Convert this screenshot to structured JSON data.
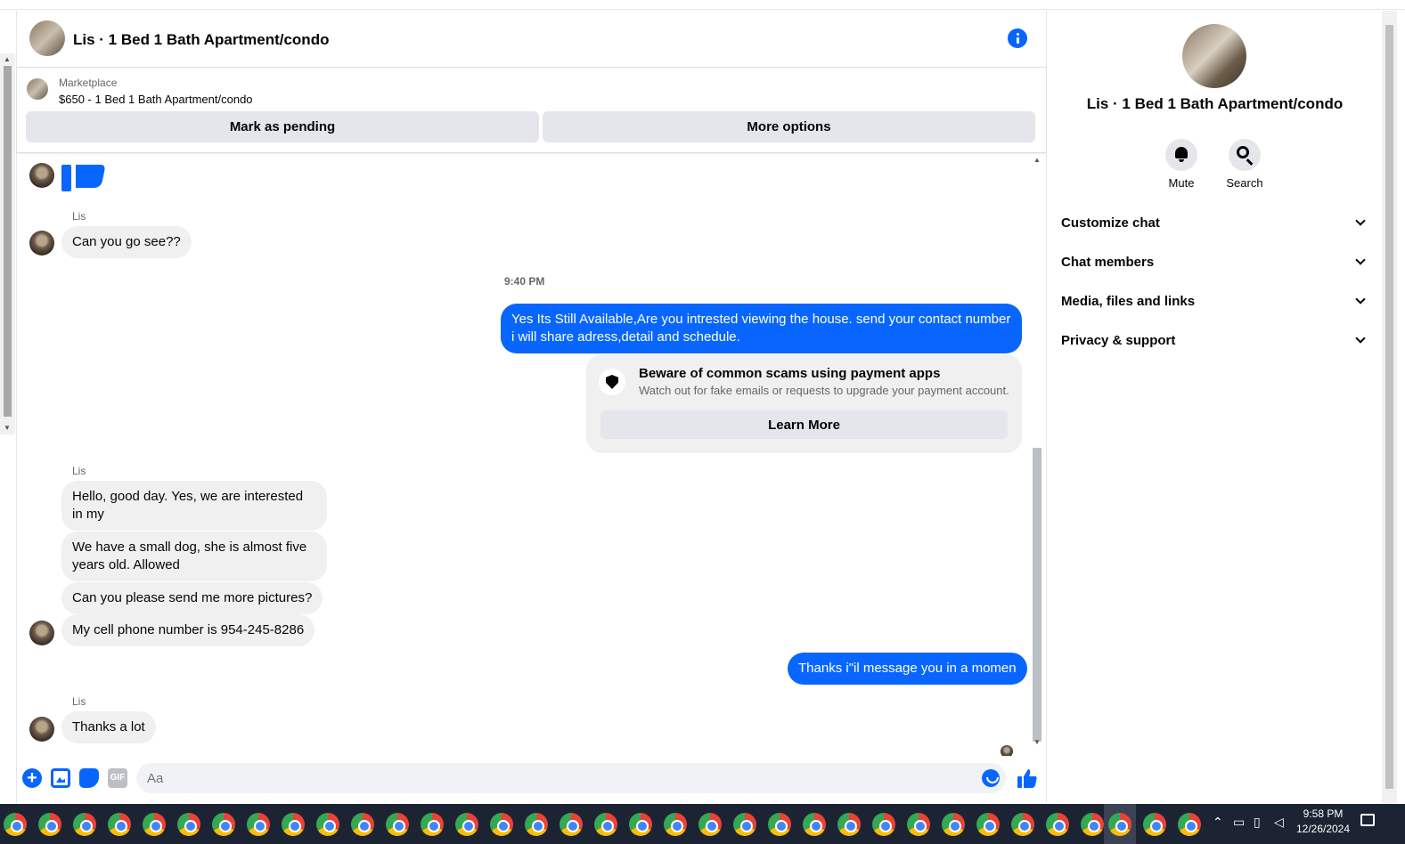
{
  "header": {
    "title": "Lis · 1 Bed 1 Bath Apartment/condo"
  },
  "listing": {
    "source": "Marketplace",
    "price_title": "$650 - 1 Bed 1 Bath Apartment/condo",
    "mark_pending": "Mark as pending",
    "more_options": "More options"
  },
  "messages": {
    "sender_name": "Lis",
    "m1": "Can you go see??",
    "timestamp": "9:40 PM",
    "out1": "Yes Its Still Available,Are you intrested viewing the house. send your contact number i will share adress,detail and schedule.",
    "warning": {
      "title": "Beware of common scams using payment apps",
      "subtitle": "Watch out for fake emails or requests to upgrade your payment account.",
      "button": "Learn More"
    },
    "m2": "Hello, good day. Yes, we are interested in my",
    "m3": "We have a small dog, she is almost five years old. Allowed",
    "m4": "Can you please send me more pictures?",
    "m5": "My cell phone number is 954-245-8286",
    "out2": "Thanks i\"il message you in a momen",
    "m6": "Thanks a lot"
  },
  "composer": {
    "placeholder": "Aa",
    "gif_label": "GIF"
  },
  "right_panel": {
    "name": "Lis · 1 Bed 1 Bath Apartment/condo",
    "actions": [
      {
        "label": "Mute",
        "icon": "bell-icon"
      },
      {
        "label": "Search",
        "icon": "search-icon"
      }
    ],
    "sections": [
      "Customize chat",
      "Chat members",
      "Media, files and links",
      "Privacy & support"
    ]
  },
  "taskbar": {
    "time": "9:58 PM",
    "date": "12/26/2024"
  },
  "colors": {
    "accent": "#0866ff",
    "bubble_in": "#f0f0f0",
    "taskbar": "#1c2434"
  }
}
